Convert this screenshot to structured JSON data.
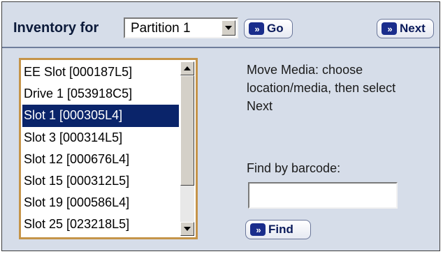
{
  "header": {
    "inventory_label": "Inventory for",
    "partition_select": {
      "value": "Partition 1"
    },
    "go_label": "Go",
    "next_label": "Next"
  },
  "media_list": {
    "items": [
      "EE Slot [000187L5]",
      "Drive 1 [053918C5]",
      "Slot 1 [000305L4]",
      "Slot 3 [000314L5]",
      "Slot 12 [000676L4]",
      "Slot 15 [000312L5]",
      "Slot 19 [000586L4]",
      "Slot 25 [023218L5]"
    ],
    "selected_index": 2
  },
  "instructions": "Move Media: choose location/media, then select Next",
  "find": {
    "label": "Find by barcode:",
    "value": "",
    "button_label": "Find"
  },
  "icons": [
    "double-chevron-right-icon",
    "dropdown-arrow-icon",
    "scroll-up-icon",
    "scroll-down-icon"
  ],
  "colors": {
    "panel_bg": "#d6dde9",
    "selected_bg": "#0a246a",
    "list_border": "#c59449",
    "button_accent": "#1a2d8c"
  }
}
